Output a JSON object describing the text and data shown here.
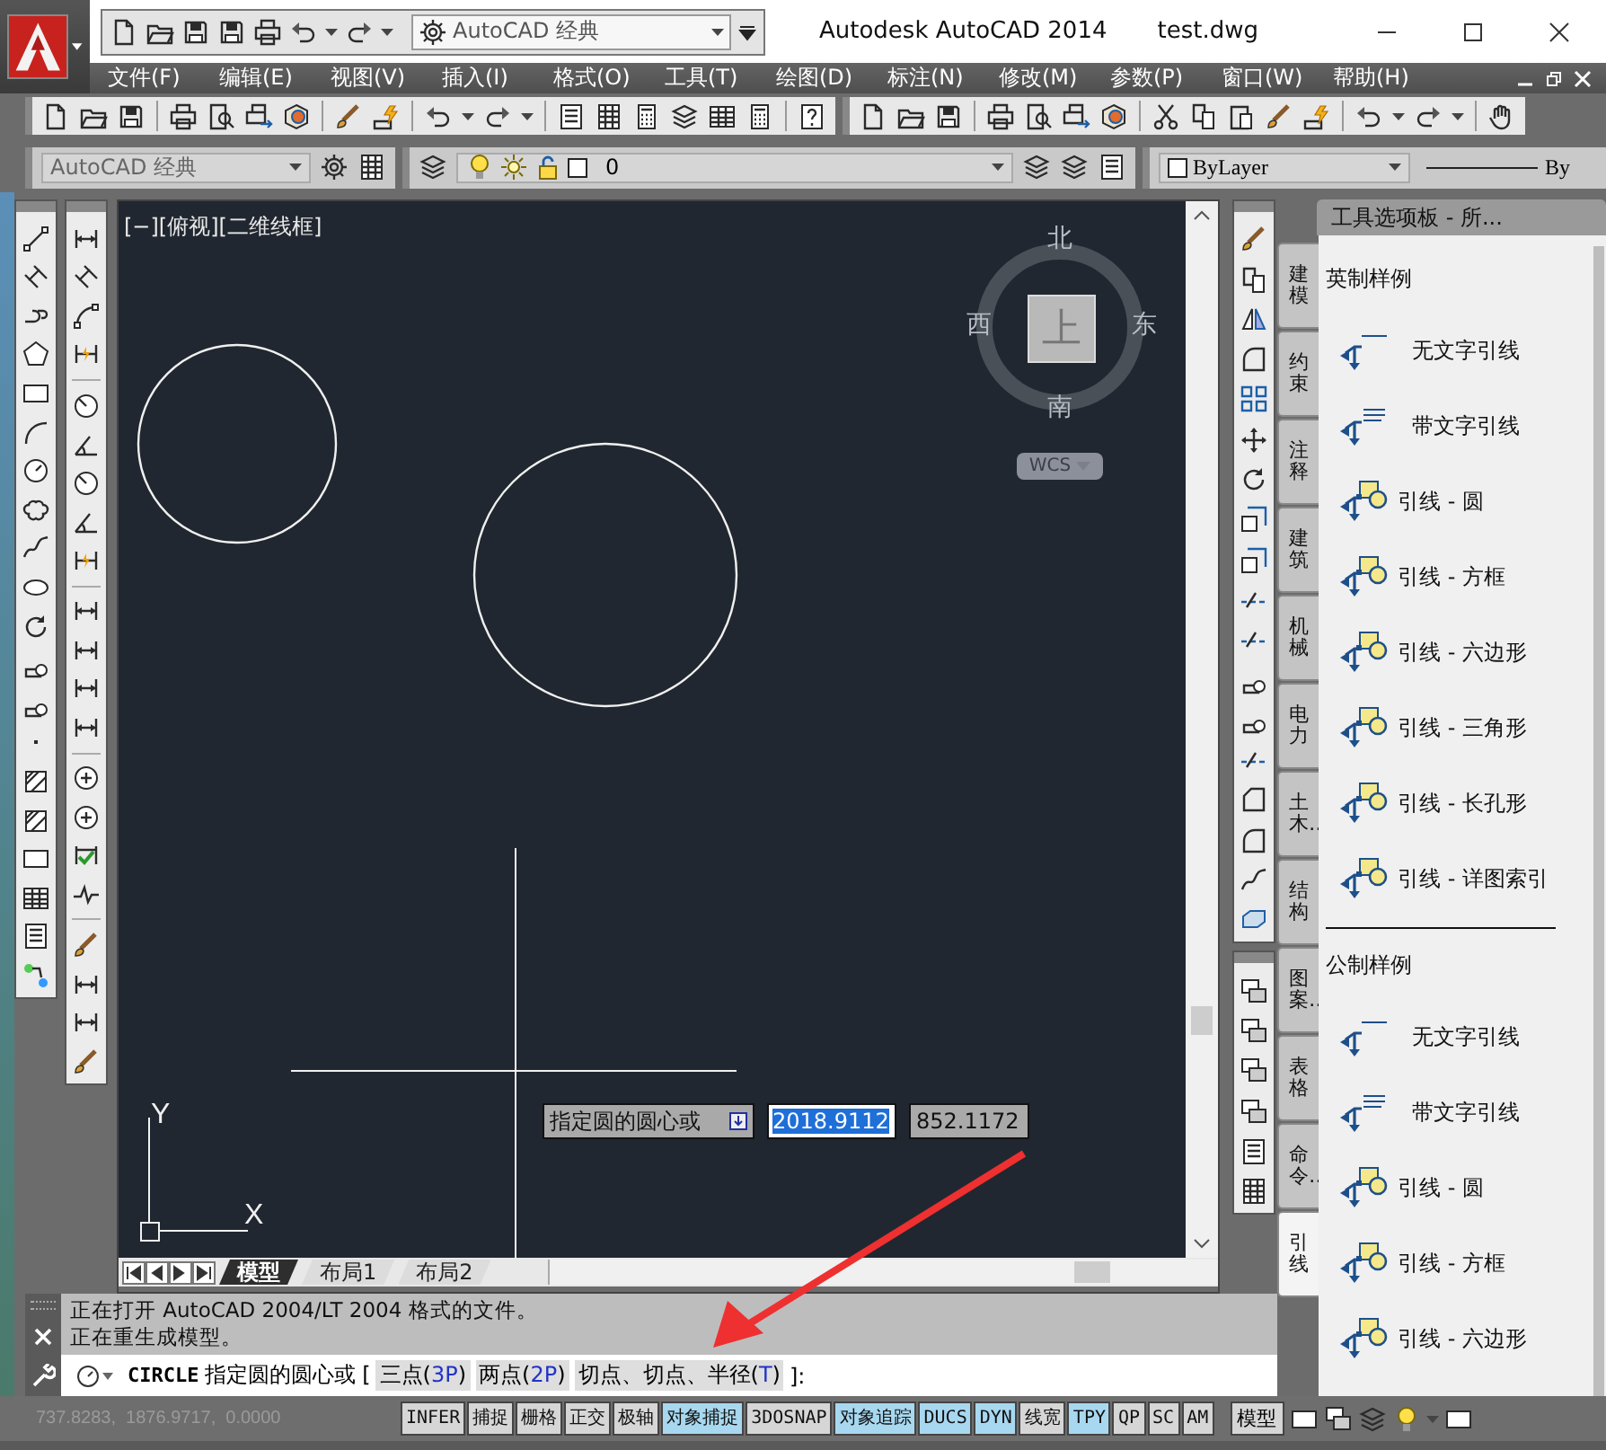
{
  "title_bar": {
    "workspace": "AutoCAD 经典",
    "app_title": "Autodesk AutoCAD 2014",
    "file_name": "test.dwg"
  },
  "menu_bar": [
    "文件(F)",
    "编辑(E)",
    "视图(V)",
    "插入(I)",
    "格式(O)",
    "工具(T)",
    "绘图(D)",
    "标注(N)",
    "修改(M)",
    "参数(P)",
    "窗口(W)",
    "帮助(H)"
  ],
  "properties_toolbar": {
    "workspace": "AutoCAD 经典",
    "layer": "0",
    "color_setting": "ByLayer",
    "linetype": "By"
  },
  "viewport": {
    "label": "[−][俯视][二维线框]",
    "viewcube": {
      "north": "北",
      "south": "南",
      "west": "西",
      "east": "东",
      "face": "上",
      "ucs_menu": "WCS"
    },
    "ucs_icon": {
      "x_label": "X",
      "y_label": "Y"
    },
    "dynamic_input": {
      "prompt": "指定圆的圆心或",
      "x_value": "2018.9112",
      "y_value": "852.1172"
    },
    "layout_tabs": [
      {
        "label": "模型",
        "selected": true
      },
      {
        "label": "布局1",
        "selected": false
      },
      {
        "label": "布局2",
        "selected": false
      }
    ]
  },
  "tool_palette": {
    "title": "工具选项板 - 所...",
    "tabs": [
      {
        "label": "建模",
        "selected": false
      },
      {
        "label": "约束",
        "selected": false
      },
      {
        "label": "注释",
        "selected": false
      },
      {
        "label": "建筑",
        "selected": false
      },
      {
        "label": "机械",
        "selected": false
      },
      {
        "label": "电力",
        "selected": false
      },
      {
        "label": "土木…",
        "selected": false
      },
      {
        "label": "结构",
        "selected": false
      },
      {
        "label": "图案…",
        "selected": false
      },
      {
        "label": "表格",
        "selected": false
      },
      {
        "label": "命令…",
        "selected": false
      },
      {
        "label": "引线",
        "selected": true
      }
    ],
    "sections": [
      {
        "heading": "英制样例",
        "items": [
          {
            "label": "无文字引线",
            "kind": "plain"
          },
          {
            "label": "带文字引线",
            "kind": "text"
          },
          {
            "label": "引线 - 圆",
            "kind": "block"
          },
          {
            "label": "引线 - 方框",
            "kind": "block"
          },
          {
            "label": "引线 - 六边形",
            "kind": "block"
          },
          {
            "label": "引线 - 三角形",
            "kind": "block"
          },
          {
            "label": "引线 - 长孔形",
            "kind": "block"
          },
          {
            "label": "引线 - 详图索引",
            "kind": "block"
          }
        ]
      },
      {
        "heading": "公制样例",
        "items": [
          {
            "label": "无文字引线",
            "kind": "plain"
          },
          {
            "label": "带文字引线",
            "kind": "text"
          },
          {
            "label": "引线 - 圆",
            "kind": "block"
          },
          {
            "label": "引线 - 方框",
            "kind": "block"
          },
          {
            "label": "引线 - 六边形",
            "kind": "block"
          }
        ]
      }
    ]
  },
  "command_history": [
    "正在打开 AutoCAD 2004/LT 2004 格式的文件。",
    "正在重生成模型。"
  ],
  "command_line": {
    "command": "CIRCLE",
    "prompt": "指定圆的圆心或 [",
    "options": [
      {
        "before": "三点(",
        "key": "3P",
        "after": ")"
      },
      {
        "before": "两点(",
        "key": "2P",
        "after": ")"
      },
      {
        "before": "切点、切点、半径(",
        "key": "T",
        "after": ")"
      }
    ],
    "end": "]:"
  },
  "status_bar": {
    "coordinates": "737.8283,  1876.9717,  0.0000",
    "toggles": [
      {
        "label": "INFER",
        "on": false
      },
      {
        "label": "捕捉",
        "on": false
      },
      {
        "label": "栅格",
        "on": false
      },
      {
        "label": "正交",
        "on": false
      },
      {
        "label": "极轴",
        "on": false
      },
      {
        "label": "对象捕捉",
        "on": true
      },
      {
        "label": "3DOSNAP",
        "on": false
      },
      {
        "label": "对象追踪",
        "on": true
      },
      {
        "label": "DUCS",
        "on": true
      },
      {
        "label": "DYN",
        "on": true
      },
      {
        "label": "线宽",
        "on": false
      },
      {
        "label": "TPY",
        "on": true
      },
      {
        "label": "QP",
        "on": false
      },
      {
        "label": "SC",
        "on": false
      },
      {
        "label": "AM",
        "on": false
      }
    ],
    "space": "模型"
  }
}
